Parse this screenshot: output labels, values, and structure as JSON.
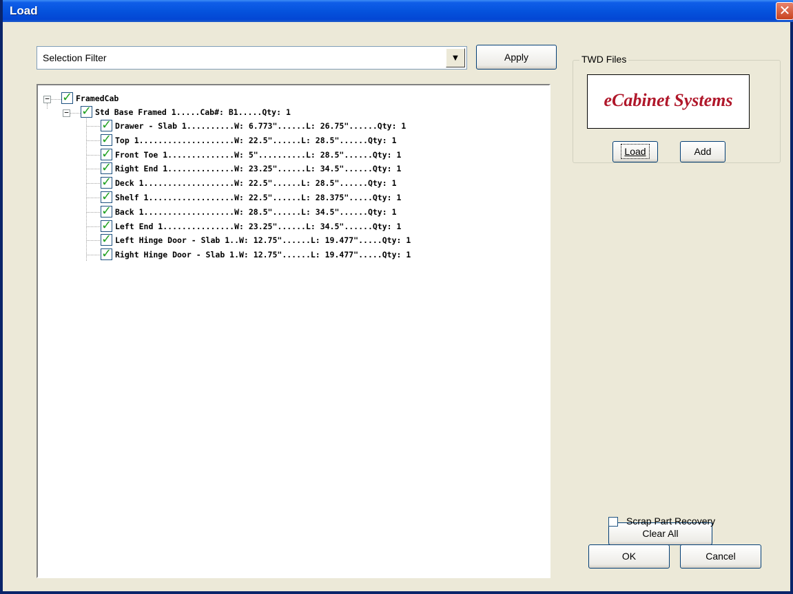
{
  "window": {
    "title": "Load",
    "close_glyph": "✕"
  },
  "filter": {
    "value": "Selection Filter",
    "arrow_glyph": "▼"
  },
  "apply_label": "Apply",
  "tree": {
    "root": {
      "label": "FramedCab",
      "checked": true
    },
    "cabinet": {
      "label": "Std Base Framed 1.....Cab#: B1.....Qty: 1",
      "checked": true
    },
    "parts": [
      {
        "label": "Drawer - Slab 1..........W: 6.773\"......L: 26.75\"......Qty: 1",
        "checked": true
      },
      {
        "label": "Top 1....................W: 22.5\"......L: 28.5\"......Qty: 1",
        "checked": true
      },
      {
        "label": "Front Toe 1..............W: 5\"..........L: 28.5\"......Qty: 1",
        "checked": true
      },
      {
        "label": "Right End 1..............W: 23.25\"......L: 34.5\"......Qty: 1",
        "checked": true
      },
      {
        "label": "Deck 1...................W: 22.5\"......L: 28.5\"......Qty: 1",
        "checked": true
      },
      {
        "label": "Shelf 1..................W: 22.5\"......L: 28.375\".....Qty: 1",
        "checked": true
      },
      {
        "label": "Back 1...................W: 28.5\"......L: 34.5\"......Qty: 1",
        "checked": true
      },
      {
        "label": "Left End 1...............W: 23.25\"......L: 34.5\"......Qty: 1",
        "checked": true
      },
      {
        "label": "Left Hinge Door - Slab 1..W: 12.75\"......L: 19.477\".....Qty: 1",
        "checked": true
      },
      {
        "label": "Right Hinge Door - Slab 1.W: 12.75\"......L: 19.477\".....Qty: 1",
        "checked": true
      }
    ],
    "check_glyph": "✓",
    "expander_glyph": "−"
  },
  "twd": {
    "legend": "TWD Files",
    "logo_text": "eCabinet Systems",
    "load_label": "Load",
    "add_label": "Add"
  },
  "clear_all_label": "Clear All",
  "scrap_label": "Scrap Part Recovery",
  "ok_label": "OK",
  "cancel_label": "Cancel",
  "colors": {
    "titlebar": "#0553DD",
    "check_green": "#21A121",
    "logo_red": "#B0172A",
    "dialog_bg": "#ECE9D8"
  }
}
